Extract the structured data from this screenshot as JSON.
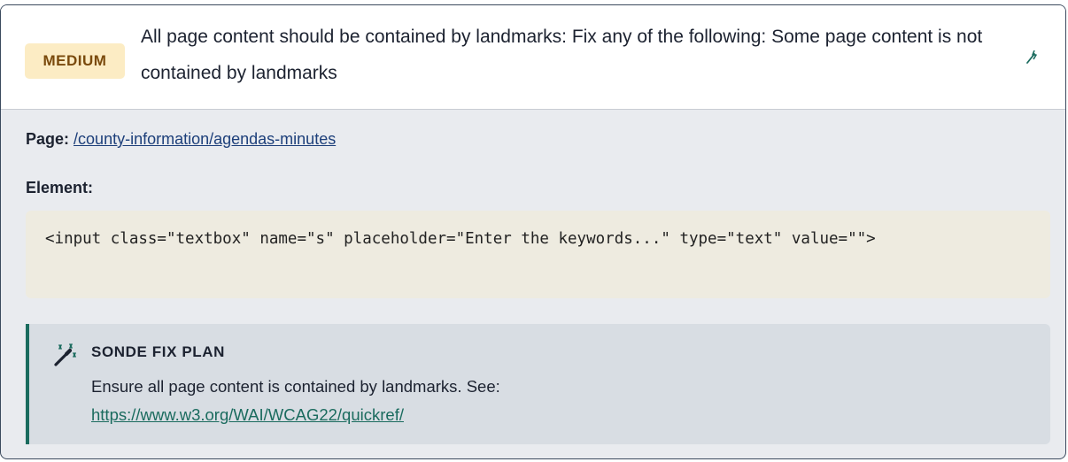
{
  "issue": {
    "severity": "MEDIUM",
    "title": "All page content should be contained by landmarks: Fix any of the following: Some page content is not contained by landmarks"
  },
  "details": {
    "page_label": "Page:",
    "page_link": "/county-information/agendas-minutes",
    "element_label": "Element:",
    "element_code": "<input class=\"textbox\" name=\"s\" placeholder=\"Enter the keywords...\" type=\"text\" value=\"\">"
  },
  "fix_plan": {
    "heading": "SONDE FIX PLAN",
    "text": "Ensure all page content is contained by landmarks. See:",
    "link": "https://www.w3.org/WAI/WCAG22/quickref/"
  },
  "icons": {
    "header_action": "wand-icon",
    "fix_plan": "magic-wand-sparkle-icon"
  },
  "colors": {
    "badge_bg": "#fcecc4",
    "badge_text": "#7a4a0c",
    "accent": "#1a6b5e",
    "link": "#1d3f7a"
  }
}
